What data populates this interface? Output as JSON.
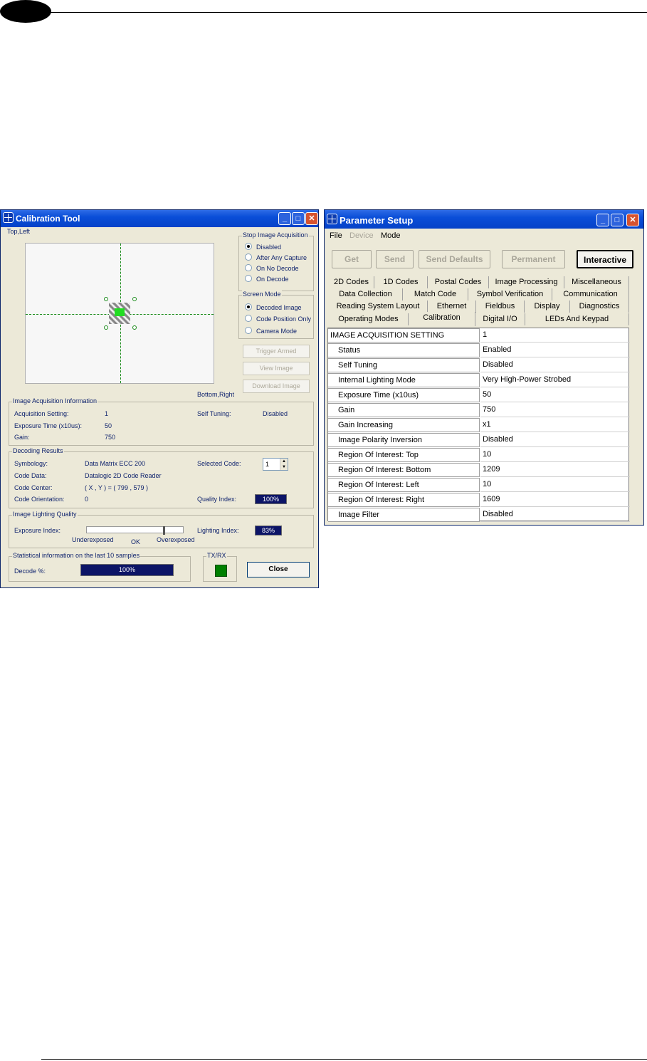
{
  "calibration_tool": {
    "title": "Calibration Tool",
    "top_left_label": "Top,Left",
    "bottom_right_label": "Bottom,Right",
    "stop_image_acquisition": {
      "title": "Stop Image Acquisition",
      "options": [
        "Disabled",
        "After Any Capture",
        "On No Decode",
        "On Decode"
      ],
      "selected": "Disabled"
    },
    "screen_mode": {
      "title": "Screen Mode",
      "options": [
        "Decoded Image",
        "Code Position Only",
        "Camera Mode"
      ],
      "selected": "Decoded Image"
    },
    "buttons": {
      "trigger_armed": "Trigger Armed",
      "view_image": "View Image",
      "download_image": "Download Image",
      "close": "Close"
    },
    "image_acquisition_info": {
      "title": "Image Acquisition Information",
      "acquisition_setting_label": "Acquisition Setting:",
      "acquisition_setting_value": "1",
      "self_tuning_label": "Self Tuning:",
      "self_tuning_value": "Disabled",
      "exposure_time_label": "Exposure Time (x10us):",
      "exposure_time_value": "50",
      "gain_label": "Gain:",
      "gain_value": "750"
    },
    "decoding_results": {
      "title": "Decoding Results",
      "symbology_label": "Symbology:",
      "symbology_value": "Data Matrix ECC 200",
      "selected_code_label": "Selected Code:",
      "selected_code_value": "1",
      "code_data_label": "Code Data:",
      "code_data_value": "Datalogic 2D Code Reader",
      "code_center_label": "Code Center:",
      "code_center_value": "( X , Y ) = ( 799 , 579 )",
      "code_orientation_label": "Code Orientation:",
      "code_orientation_value": "0",
      "quality_index_label": "Quality Index:",
      "quality_index_value": "100%"
    },
    "image_lighting_quality": {
      "title": "Image Lighting Quality",
      "exposure_index_label": "Exposure Index:",
      "exposure_index_level": 0.79,
      "underexposed_label": "Underexposed",
      "ok_label": "OK",
      "overexposed_label": "Overexposed",
      "lighting_index_label": "Lighting Index:",
      "lighting_index_value": "83%"
    },
    "statistics": {
      "title": "Statistical information on the last 10 samples",
      "decode_label": "Decode %:",
      "decode_value": "100%"
    },
    "txrx": {
      "title": "TX/RX",
      "indicator_color": "#008000"
    }
  },
  "parameter_setup": {
    "title": "Parameter Setup",
    "menu": [
      "File",
      "Device",
      "Mode"
    ],
    "toolbar": [
      "Get",
      "Send",
      "Send Defaults",
      "Permanent",
      "Interactive"
    ],
    "tabs_row1": [
      "2D Codes",
      "1D Codes",
      "Postal Codes",
      "Image Processing",
      "Miscellaneous"
    ],
    "tabs_row2": [
      "Data Collection",
      "Match Code",
      "Symbol Verification",
      "Communication"
    ],
    "tabs_row3": [
      "Reading System Layout",
      "Ethernet",
      "Fieldbus",
      "Display",
      "Diagnostics"
    ],
    "tabs_row4": [
      "Operating Modes",
      "Calibration",
      "Digital I/O",
      "LEDs And Keypad"
    ],
    "active_tab": "Calibration",
    "rows": [
      {
        "name": "IMAGE ACQUISITION SETTING",
        "value": "1"
      },
      {
        "name": "Status",
        "value": "Enabled"
      },
      {
        "name": "Self Tuning",
        "value": "Disabled"
      },
      {
        "name": "Internal Lighting Mode",
        "value": "Very High-Power Strobed"
      },
      {
        "name": "Exposure Time (x10us)",
        "value": "50"
      },
      {
        "name": "Gain",
        "value": "750"
      },
      {
        "name": "Gain Increasing",
        "value": "x1"
      },
      {
        "name": "Image Polarity Inversion",
        "value": "Disabled"
      },
      {
        "name": "Region Of Interest: Top",
        "value": "10"
      },
      {
        "name": "Region Of Interest: Bottom",
        "value": "1209"
      },
      {
        "name": "Region Of Interest: Left",
        "value": "10"
      },
      {
        "name": "Region Of Interest: Right",
        "value": "1609"
      },
      {
        "name": "Image Filter",
        "value": "Disabled"
      }
    ]
  },
  "colors": {
    "title_bar": "#0a4ed8",
    "window_face": "#ece9d8",
    "navy_indicator": "#0c1466",
    "label_text": "#10246e"
  }
}
